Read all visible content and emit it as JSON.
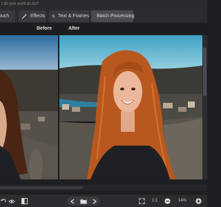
{
  "header": {
    "prompt": "t do you want to do?"
  },
  "tabs": [
    {
      "label": "ouch",
      "icon": "brush-icon"
    },
    {
      "label": "Effects",
      "icon": "effects-icon"
    },
    {
      "label": "Text & Frames",
      "icon": "text-frames-icon"
    },
    {
      "label": "Batch Processing",
      "icon": "batch-icon"
    }
  ],
  "compare": {
    "before_label": "Before",
    "after_label": "After"
  },
  "bottombar": {
    "actual_size_label": "1:1",
    "zoom_level": "14%"
  },
  "colors": {
    "background": "#1e1f22",
    "toolbar": "#2b2c2f",
    "tab": "#38393d",
    "active_tab": "#4a4b50",
    "hair": "#b8581f",
    "sky": "#56a9c7"
  }
}
